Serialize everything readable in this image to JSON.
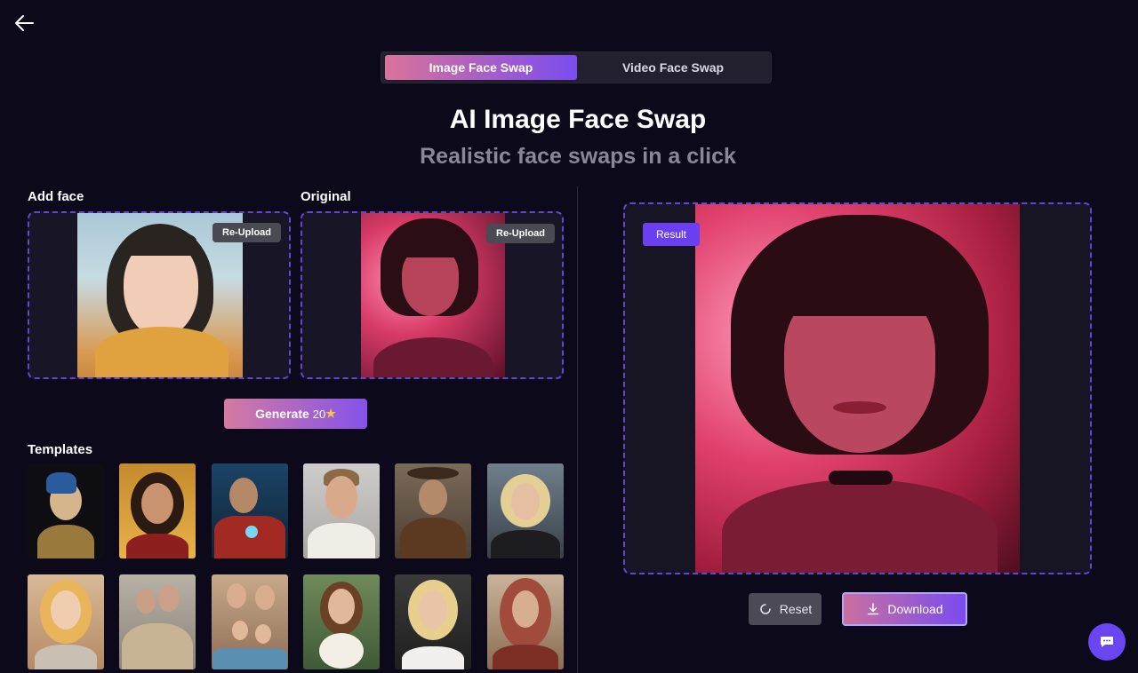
{
  "nav": {
    "back_icon": "arrow-left-icon"
  },
  "tabs": [
    {
      "label": "Image Face Swap",
      "active": true
    },
    {
      "label": "Video Face Swap",
      "active": false
    }
  ],
  "hero": {
    "title": "AI Image Face Swap",
    "subtitle": "Realistic face swaps in a click"
  },
  "add_face": {
    "label": "Add face",
    "reupload_label": "Re-Upload"
  },
  "original": {
    "label": "Original",
    "reupload_label": "Re-Upload"
  },
  "generate": {
    "label": "Generate",
    "cost": "20",
    "star_icon": "star-icon"
  },
  "templates": {
    "heading": "Templates"
  },
  "result": {
    "badge": "Result",
    "reset_label": "Reset",
    "download_label": "Download",
    "reset_icon": "refresh-icon",
    "download_icon": "download-icon"
  },
  "chat": {
    "icon": "chat-icon"
  },
  "colors": {
    "background": "#0c0a1a",
    "accent": "#6a3ff2",
    "gradient_start": "#d9739a",
    "gradient_end": "#7b4cf0",
    "muted_text": "#8a8796"
  }
}
